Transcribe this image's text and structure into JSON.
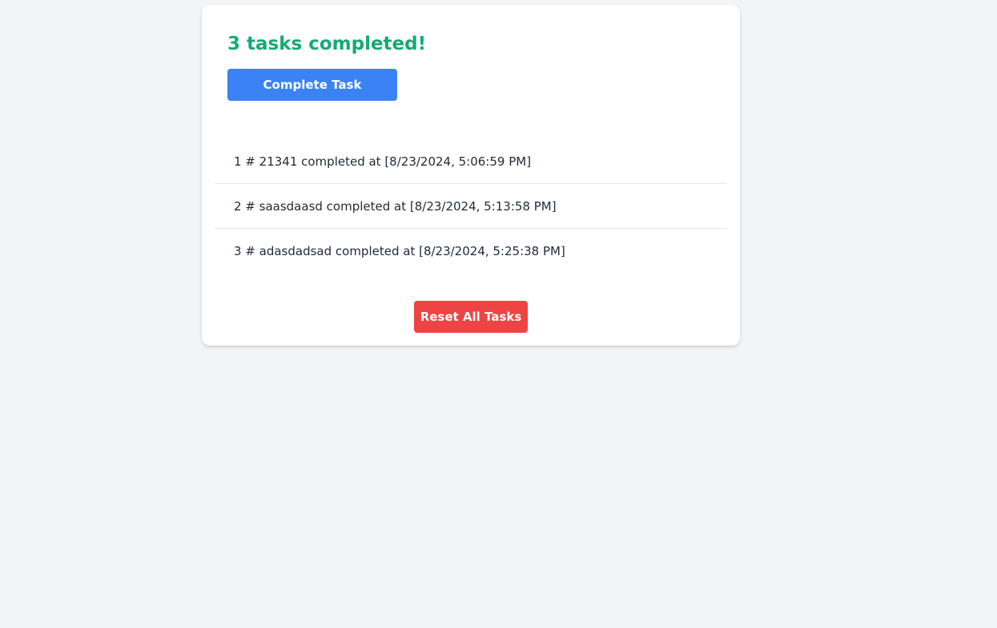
{
  "header": {
    "title": "3 tasks completed!"
  },
  "actions": {
    "complete_label": "Complete Task",
    "reset_label": "Reset All Tasks"
  },
  "tasks": [
    {
      "text": "1 # 21341 completed at [8/23/2024, 5:06:59 PM]"
    },
    {
      "text": "2 # saasdaasd completed at [8/23/2024, 5:13:58 PM]"
    },
    {
      "text": "3 # adasdadsad completed at [8/23/2024, 5:25:38 PM]"
    }
  ],
  "colors": {
    "title": "#16a974",
    "primary": "#3b82f6",
    "danger": "#ef4444",
    "background": "#f3f4f6"
  }
}
